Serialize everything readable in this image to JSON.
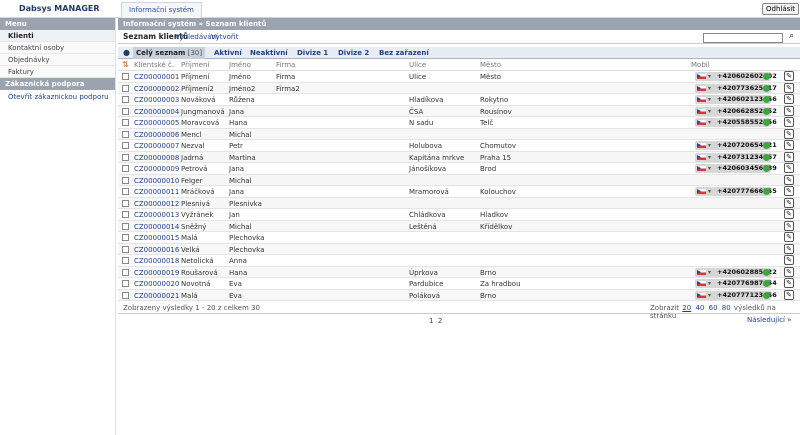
{
  "app": {
    "title": "Dabsys MANAGER",
    "module_tab": "Informační systém",
    "logout": "Odhlásit"
  },
  "sidebar": {
    "section1": "Menu",
    "items": [
      {
        "label": "Klienti",
        "active": true
      },
      {
        "label": "Kontaktní osoby",
        "active": false
      },
      {
        "label": "Objednávky",
        "active": false
      },
      {
        "label": "Faktury",
        "active": false
      }
    ],
    "section2": "Zákaznická podpora",
    "support_link": "Otevřít zákaznickou podporu"
  },
  "breadcrumb": "Informační systém » Seznam klientů",
  "page": {
    "title": "Seznam klientů",
    "search_link": "Vyhledávání",
    "create_link": "Vytvořit",
    "search_placeholder": ""
  },
  "tabs": {
    "bullet": "●",
    "items": [
      {
        "label": "Celý seznam",
        "count": "[30]",
        "selected": true
      },
      {
        "label": "Aktivní",
        "count": "",
        "selected": false
      },
      {
        "label": "Neaktivní",
        "count": "",
        "selected": false
      },
      {
        "label": "Divize 1",
        "count": "",
        "selected": false
      },
      {
        "label": "Divize 2",
        "count": "",
        "selected": false
      },
      {
        "label": "Bez zařazení",
        "count": "",
        "selected": false
      }
    ]
  },
  "table": {
    "columns": [
      "Klientské č.",
      "Příjmení",
      "Jméno",
      "Firma",
      "Ulice",
      "Město",
      "Mobil"
    ],
    "rows": [
      [
        "CZ00000001",
        "Příjmení",
        "Jméno",
        "Firma",
        "Ulice",
        "Město",
        "+420602602602"
      ],
      [
        "CZ00000002",
        "Příjmení2",
        "Jméno2",
        "Firma2",
        "",
        "",
        "+420773625817"
      ],
      [
        "CZ00000003",
        "Nováková",
        "Růžena",
        "",
        "Hladíkova",
        "Rokytno",
        "+420602123456"
      ],
      [
        "CZ00000004",
        "Jungmanová",
        "Jana",
        "",
        "ČSA",
        "Rousínov",
        "+420662852852"
      ],
      [
        "CZ00000005",
        "Moravcová",
        "Hana",
        "",
        "N sadu",
        "Telč",
        "+420558552556"
      ],
      [
        "CZ00000006",
        "Mencl",
        "Michal",
        "",
        "",
        "",
        ""
      ],
      [
        "CZ00000007",
        "Nezval",
        "Petr",
        "",
        "Holubova",
        "Chomutov",
        "+420720654321"
      ],
      [
        "CZ00000008",
        "Jadrná",
        "Martina",
        "",
        "Kapitána mrkve",
        "Praha 15",
        "+420731234567"
      ],
      [
        "CZ00000009",
        "Petrová",
        "Jana",
        "",
        "Jánošíkova",
        "Brod",
        "+420603456789"
      ],
      [
        "CZ00000010",
        "Felger",
        "Michal",
        "",
        "",
        "",
        ""
      ],
      [
        "CZ00000011",
        "Mráčková",
        "Jana",
        "",
        "Mramorová",
        "Kolouchov",
        "+420777666555"
      ],
      [
        "CZ00000012",
        "Plesnivá",
        "Plesnivka",
        "",
        "",
        "",
        ""
      ],
      [
        "CZ00000013",
        "Vyžránek",
        "Jan",
        "",
        "Chládkova",
        "Hladkov",
        ""
      ],
      [
        "CZ00000014",
        "Sněžný",
        "Michal",
        "",
        "Leštěná",
        "Křídělkov",
        ""
      ],
      [
        "CZ00000015",
        "Malá",
        "Plechovka",
        "",
        "",
        "",
        ""
      ],
      [
        "CZ00000016",
        "Velká",
        "Plechovka",
        "",
        "",
        "",
        ""
      ],
      [
        "CZ00000018",
        "Netolická",
        "Anna",
        "",
        "",
        "",
        ""
      ],
      [
        "CZ00000019",
        "Roušarová",
        "Hana",
        "",
        "Úprkova",
        "Brno",
        "+420602885522"
      ],
      [
        "CZ00000020",
        "Novotná",
        "Eva",
        "",
        "Pardubice",
        "Za hradbou",
        "+420776987654"
      ],
      [
        "CZ00000021",
        "Malá",
        "Eva",
        "",
        "Poláková",
        "Brno",
        "+420777123456"
      ]
    ]
  },
  "footer": {
    "summary": "Zobrazeny výsledky 1 - 20 z celkem 30",
    "show": "Zobrazit",
    "perpage": [
      "20",
      "40",
      "60",
      "80"
    ],
    "perpage_suffix": "výsledků na stránku",
    "pages": [
      "1",
      "2"
    ],
    "next": "Následující »"
  }
}
